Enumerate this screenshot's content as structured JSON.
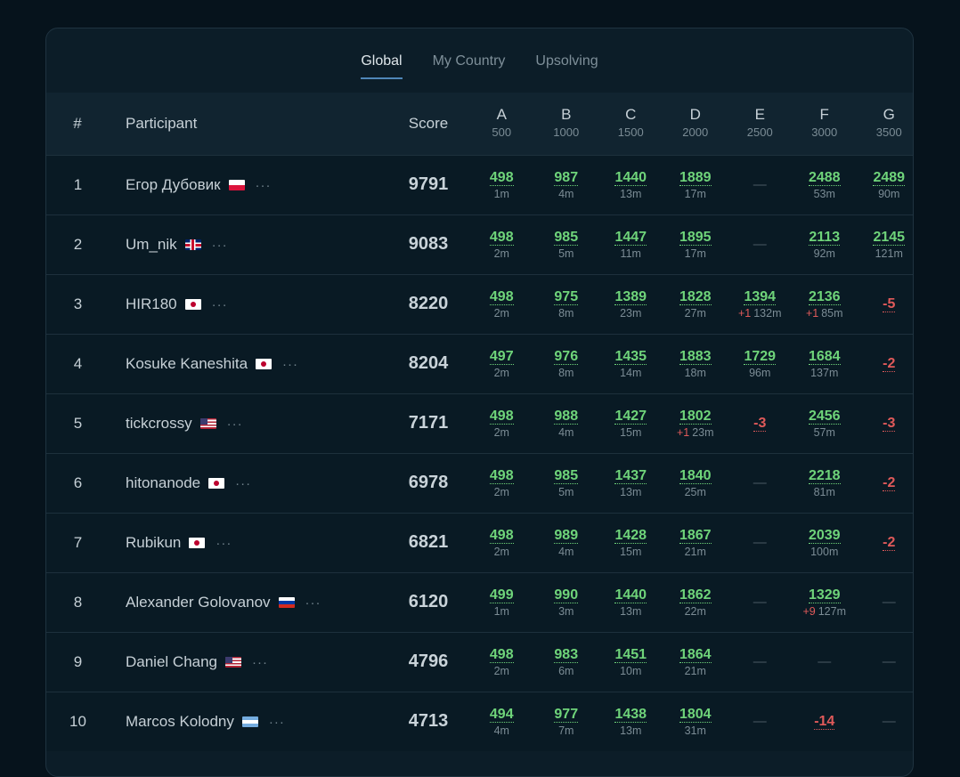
{
  "tabs": [
    {
      "label": "Global",
      "active": true
    },
    {
      "label": "My Country",
      "active": false
    },
    {
      "label": "Upsolving",
      "active": false
    }
  ],
  "header": {
    "rank": "#",
    "participant": "Participant",
    "score": "Score",
    "problems": [
      {
        "letter": "A",
        "points": "500"
      },
      {
        "letter": "B",
        "points": "1000"
      },
      {
        "letter": "C",
        "points": "1500"
      },
      {
        "letter": "D",
        "points": "2000"
      },
      {
        "letter": "E",
        "points": "2500"
      },
      {
        "letter": "F",
        "points": "3000"
      },
      {
        "letter": "G",
        "points": "3500"
      }
    ]
  },
  "more_glyph": "···",
  "dash_glyph": "—",
  "rows": [
    {
      "rank": "1",
      "name": "Егор Дубовик",
      "flag": "flag-pl",
      "score": "9791",
      "cells": [
        {
          "v": "498",
          "t": "1m"
        },
        {
          "v": "987",
          "t": "4m"
        },
        {
          "v": "1440",
          "t": "13m"
        },
        {
          "v": "1889",
          "t": "17m"
        },
        {
          "dash": true
        },
        {
          "v": "2488",
          "t": "53m"
        },
        {
          "v": "2489",
          "t": "90m"
        }
      ]
    },
    {
      "rank": "2",
      "name": "Um_nik",
      "flag": "flag-gb",
      "score": "9083",
      "cells": [
        {
          "v": "498",
          "t": "2m"
        },
        {
          "v": "985",
          "t": "5m"
        },
        {
          "v": "1447",
          "t": "11m"
        },
        {
          "v": "1895",
          "t": "17m"
        },
        {
          "dash": true
        },
        {
          "v": "2113",
          "t": "92m"
        },
        {
          "v": "2145",
          "t": "121m"
        }
      ]
    },
    {
      "rank": "3",
      "name": "HIR180",
      "flag": "flag-jp",
      "score": "8220",
      "cells": [
        {
          "v": "498",
          "t": "2m"
        },
        {
          "v": "975",
          "t": "8m"
        },
        {
          "v": "1389",
          "t": "23m"
        },
        {
          "v": "1828",
          "t": "27m"
        },
        {
          "v": "1394",
          "p": "+1",
          "t": "132m"
        },
        {
          "v": "2136",
          "p": "+1",
          "t": "85m"
        },
        {
          "v": "-5",
          "neg": true
        }
      ]
    },
    {
      "rank": "4",
      "name": "Kosuke Kaneshita",
      "flag": "flag-jp",
      "score": "8204",
      "cells": [
        {
          "v": "497",
          "t": "2m"
        },
        {
          "v": "976",
          "t": "8m"
        },
        {
          "v": "1435",
          "t": "14m"
        },
        {
          "v": "1883",
          "t": "18m"
        },
        {
          "v": "1729",
          "t": "96m"
        },
        {
          "v": "1684",
          "t": "137m"
        },
        {
          "v": "-2",
          "neg": true
        }
      ]
    },
    {
      "rank": "5",
      "name": "tickcrossy",
      "flag": "flag-us",
      "score": "7171",
      "cells": [
        {
          "v": "498",
          "t": "2m"
        },
        {
          "v": "988",
          "t": "4m"
        },
        {
          "v": "1427",
          "t": "15m"
        },
        {
          "v": "1802",
          "p": "+1",
          "t": "23m"
        },
        {
          "v": "-3",
          "neg": true
        },
        {
          "v": "2456",
          "t": "57m"
        },
        {
          "v": "-3",
          "neg": true
        }
      ]
    },
    {
      "rank": "6",
      "name": "hitonanode",
      "flag": "flag-jp",
      "score": "6978",
      "cells": [
        {
          "v": "498",
          "t": "2m"
        },
        {
          "v": "985",
          "t": "5m"
        },
        {
          "v": "1437",
          "t": "13m"
        },
        {
          "v": "1840",
          "t": "25m"
        },
        {
          "dash": true
        },
        {
          "v": "2218",
          "t": "81m"
        },
        {
          "v": "-2",
          "neg": true
        }
      ]
    },
    {
      "rank": "7",
      "name": "Rubikun",
      "flag": "flag-jp",
      "score": "6821",
      "cells": [
        {
          "v": "498",
          "t": "2m"
        },
        {
          "v": "989",
          "t": "4m"
        },
        {
          "v": "1428",
          "t": "15m"
        },
        {
          "v": "1867",
          "t": "21m"
        },
        {
          "dash": true
        },
        {
          "v": "2039",
          "t": "100m"
        },
        {
          "v": "-2",
          "neg": true
        }
      ]
    },
    {
      "rank": "8",
      "name": "Alexander Golovanov",
      "flag": "flag-ru",
      "score": "6120",
      "cells": [
        {
          "v": "499",
          "t": "1m"
        },
        {
          "v": "990",
          "t": "3m"
        },
        {
          "v": "1440",
          "t": "13m"
        },
        {
          "v": "1862",
          "t": "22m"
        },
        {
          "dash": true
        },
        {
          "v": "1329",
          "p": "+9",
          "t": "127m"
        },
        {
          "dash": true
        }
      ]
    },
    {
      "rank": "9",
      "name": "Daniel Chang",
      "flag": "flag-us",
      "score": "4796",
      "cells": [
        {
          "v": "498",
          "t": "2m"
        },
        {
          "v": "983",
          "t": "6m"
        },
        {
          "v": "1451",
          "t": "10m"
        },
        {
          "v": "1864",
          "t": "21m"
        },
        {
          "dash": true
        },
        {
          "dash": true
        },
        {
          "dash": true
        }
      ]
    },
    {
      "rank": "10",
      "name": "Marcos Kolodny",
      "flag": "flag-ar",
      "score": "4713",
      "cells": [
        {
          "v": "494",
          "t": "4m"
        },
        {
          "v": "977",
          "t": "7m"
        },
        {
          "v": "1438",
          "t": "13m"
        },
        {
          "v": "1804",
          "t": "31m"
        },
        {
          "dash": true
        },
        {
          "v": "-14",
          "neg": true
        },
        {
          "dash": true
        }
      ]
    }
  ]
}
